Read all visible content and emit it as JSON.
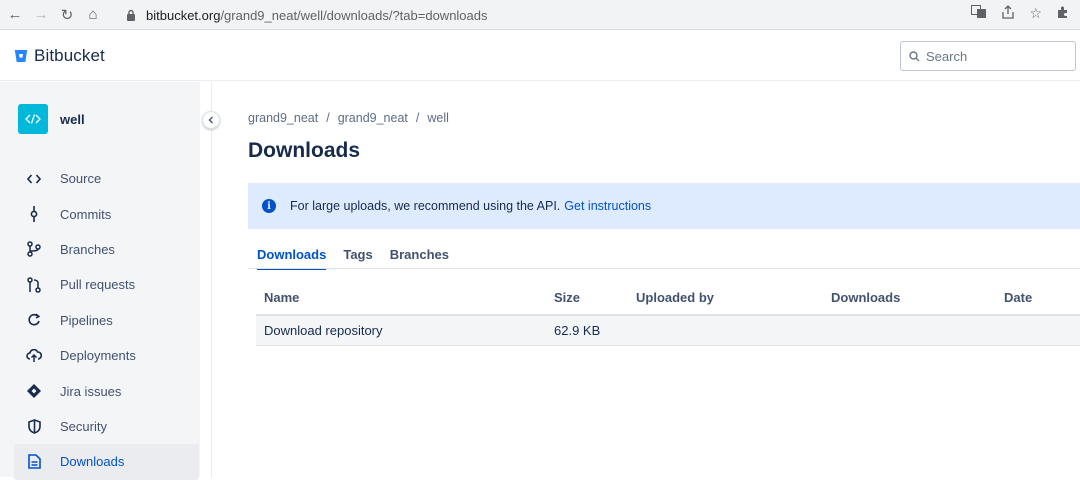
{
  "browser": {
    "url_host": "bitbucket.org",
    "url_path": "/grand9_neat/well/downloads/?tab=downloads"
  },
  "app": {
    "brand": "Bitbucket",
    "search_placeholder": "Search"
  },
  "repo": {
    "name": "well"
  },
  "sidebar": {
    "items": [
      {
        "label": "Source",
        "icon": "code-icon"
      },
      {
        "label": "Commits",
        "icon": "commit-icon"
      },
      {
        "label": "Branches",
        "icon": "branch-icon"
      },
      {
        "label": "Pull requests",
        "icon": "pull-request-icon"
      },
      {
        "label": "Pipelines",
        "icon": "pipelines-icon"
      },
      {
        "label": "Deployments",
        "icon": "deployments-icon"
      },
      {
        "label": "Jira issues",
        "icon": "jira-icon"
      },
      {
        "label": "Security",
        "icon": "shield-icon"
      },
      {
        "label": "Downloads",
        "icon": "downloads-icon",
        "active": true
      }
    ]
  },
  "breadcrumb": [
    "grand9_neat",
    "grand9_neat",
    "well"
  ],
  "page": {
    "title": "Downloads"
  },
  "banner": {
    "text": "For large uploads, we recommend using the API.",
    "link": "Get instructions"
  },
  "tabs": [
    {
      "label": "Downloads",
      "active": true
    },
    {
      "label": "Tags"
    },
    {
      "label": "Branches"
    }
  ],
  "table": {
    "headers": [
      "Name",
      "Size",
      "Uploaded by",
      "Downloads",
      "Date"
    ],
    "rows": [
      [
        "Download repository",
        "62.9 KB",
        "",
        "",
        ""
      ]
    ]
  },
  "colors": {
    "accent": "#0052cc",
    "banner_bg": "#deebff",
    "repo_avatar": "#00b8d9"
  }
}
